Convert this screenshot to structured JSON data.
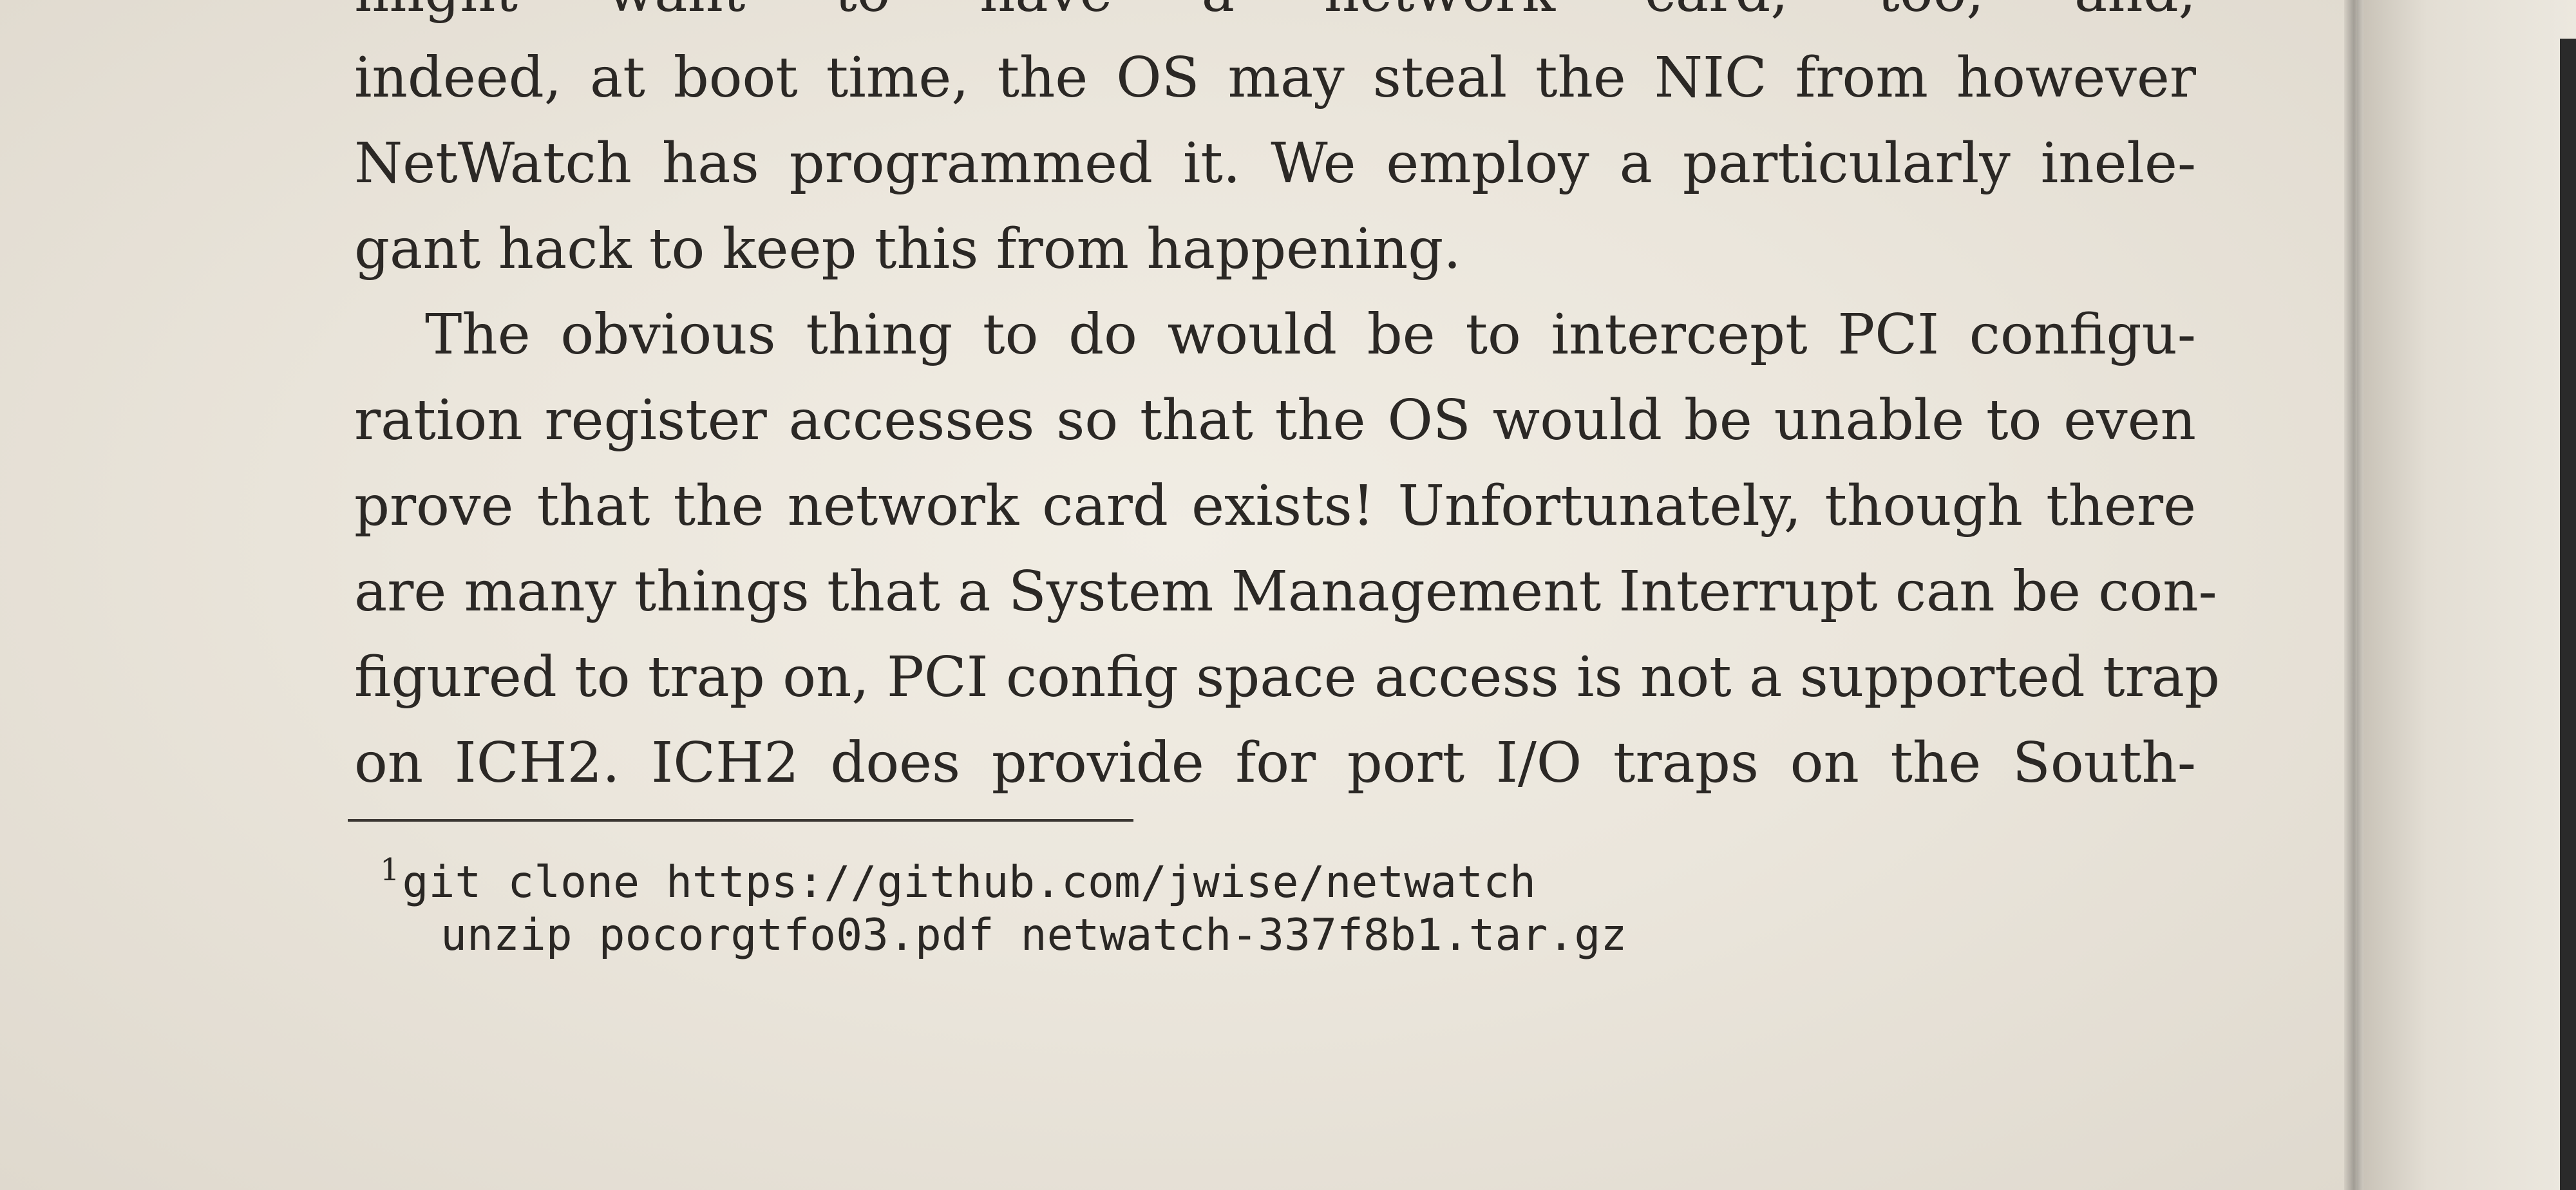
{
  "body_text": {
    "lines": [
      "might want to have a network card, too; and,",
      "indeed, at boot time, the OS may steal the NIC from however",
      "NetWatch has programmed it. We employ a particularly inele-",
      "gant hack to keep this from happening.",
      "The obvious thing to do would be to intercept PCI configu-",
      "ration register accesses so that the OS would be unable to even",
      "prove that the network card exists! Unfortunately, though there",
      "are many things that a System Management Interrupt can be con-",
      "figured to trap on, PCI config space access is not a supported trap",
      "on ICH2. ICH2 does provide for port I/O traps on the South-"
    ]
  },
  "footnote": {
    "marker": "1",
    "lines": [
      "git clone https://github.com/jwise/netwatch",
      "unzip pocorgtfo03.pdf netwatch-337f8b1.tar.gz"
    ]
  }
}
